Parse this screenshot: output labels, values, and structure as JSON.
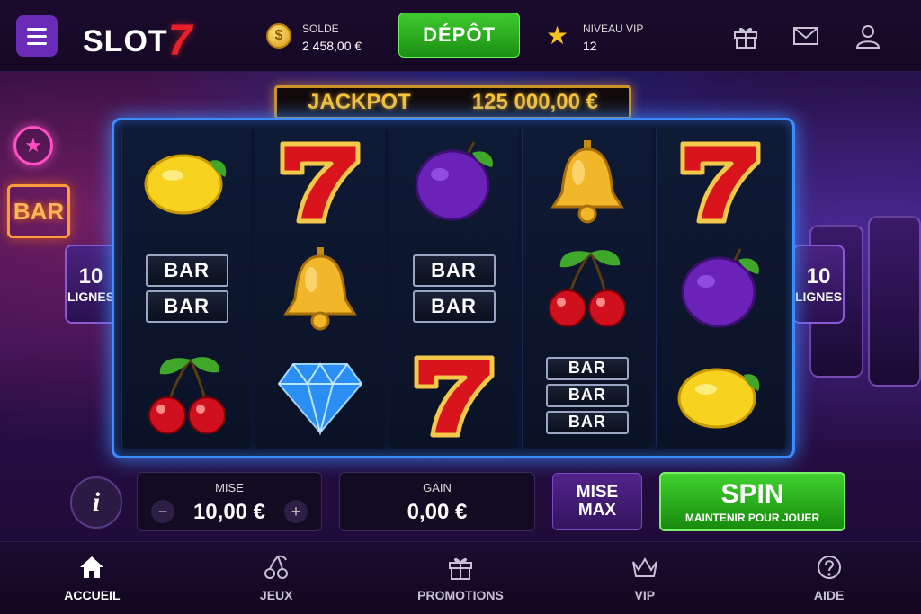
{
  "header": {
    "logo_text": "SLOT",
    "logo_number": "7",
    "balance_label": "SOLDE",
    "balance_value": "2 458,00 €",
    "deposit_label": "DÉPÔT",
    "vip_label": "NIVEAU VIP",
    "vip_value": "12"
  },
  "jackpot": {
    "label": "JACKPOT",
    "value": "125 000,00 €"
  },
  "reels": [
    [
      "lemon",
      "bar-2",
      "cherry"
    ],
    [
      "seven",
      "bell",
      "diamond"
    ],
    [
      "plum",
      "bar-2",
      "seven"
    ],
    [
      "bell",
      "cherry",
      "bar-3"
    ],
    [
      "seven",
      "plum",
      "lemon"
    ]
  ],
  "bar_text": "BAR",
  "lines": {
    "count": "10",
    "label": "LIGNES"
  },
  "controls": {
    "info_label": "i",
    "bet_label": "MISE",
    "bet_value": "10,00 €",
    "minus": "−",
    "plus": "+",
    "win_label": "GAIN",
    "win_value": "0,00 €",
    "max_bet_line1": "MISE",
    "max_bet_line2": "MAX",
    "spin_label": "SPIN",
    "spin_hint": "MAINTENIR POUR JOUER"
  },
  "nav": {
    "items": [
      {
        "label": "ACCUEIL",
        "icon": "home-icon"
      },
      {
        "label": "JEUX",
        "icon": "cherry-icon"
      },
      {
        "label": "PROMOTIONS",
        "icon": "gift-icon"
      },
      {
        "label": "VIP",
        "icon": "crown-icon"
      },
      {
        "label": "AIDE",
        "icon": "help-icon"
      }
    ],
    "active": "ACCUEIL"
  },
  "colors": {
    "accent_green": "#2eb81f",
    "brand_purple": "#6a2bb8",
    "jackpot_gold": "#f7c33a",
    "reel_glow": "#3d8cff"
  }
}
